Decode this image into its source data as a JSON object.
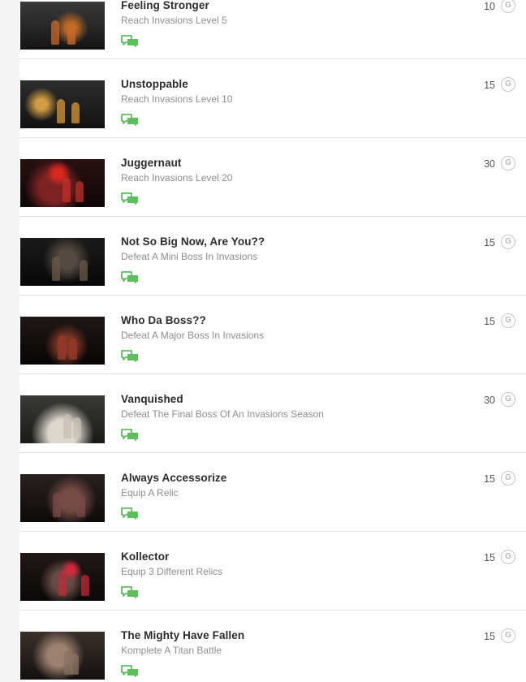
{
  "achievements": [
    {
      "title": "Feeling Stronger",
      "description": "Reach Invasions Level 5",
      "gamerscore": "10",
      "badge": "G",
      "icon": "comment-icon",
      "accent": "#c96a2a"
    },
    {
      "title": "Unstoppable",
      "description": "Reach Invasions Level 10",
      "gamerscore": "15",
      "badge": "G",
      "icon": "comment-icon",
      "accent": "#d89a3a"
    },
    {
      "title": "Juggernaut",
      "description": "Reach Invasions Level 20",
      "gamerscore": "30",
      "badge": "G",
      "icon": "comment-icon",
      "accent": "#c0302a"
    },
    {
      "title": "Not So Big Now, Are You??",
      "description": "Defeat A Mini Boss In Invasions",
      "gamerscore": "15",
      "badge": "G",
      "icon": "comment-icon",
      "accent": "#6a5a4a"
    },
    {
      "title": "Who Da Boss??",
      "description": "Defeat A Major Boss In Invasions",
      "gamerscore": "15",
      "badge": "G",
      "icon": "comment-icon",
      "accent": "#9a3a2a"
    },
    {
      "title": "Vanquished",
      "description": "Defeat The Final Boss Of An Invasions Season",
      "gamerscore": "30",
      "badge": "G",
      "icon": "comment-icon",
      "accent": "#c8c0b0"
    },
    {
      "title": "Always Accessorize",
      "description": "Equip A Relic",
      "gamerscore": "15",
      "badge": "G",
      "icon": "comment-icon",
      "accent": "#7a4a4a"
    },
    {
      "title": "Kollector",
      "description": "Equip 3 Different Relics",
      "gamerscore": "15",
      "badge": "G",
      "icon": "comment-icon",
      "accent": "#c02a3a"
    },
    {
      "title": "The Mighty Have Fallen",
      "description": "Komplete A Titan Battle",
      "gamerscore": "15",
      "badge": "G",
      "icon": "comment-icon",
      "accent": "#8a7060"
    }
  ],
  "colors": {
    "comment_icon": "#5cbf5c",
    "title": "#2b2b2b",
    "description": "#8d8d8d"
  }
}
